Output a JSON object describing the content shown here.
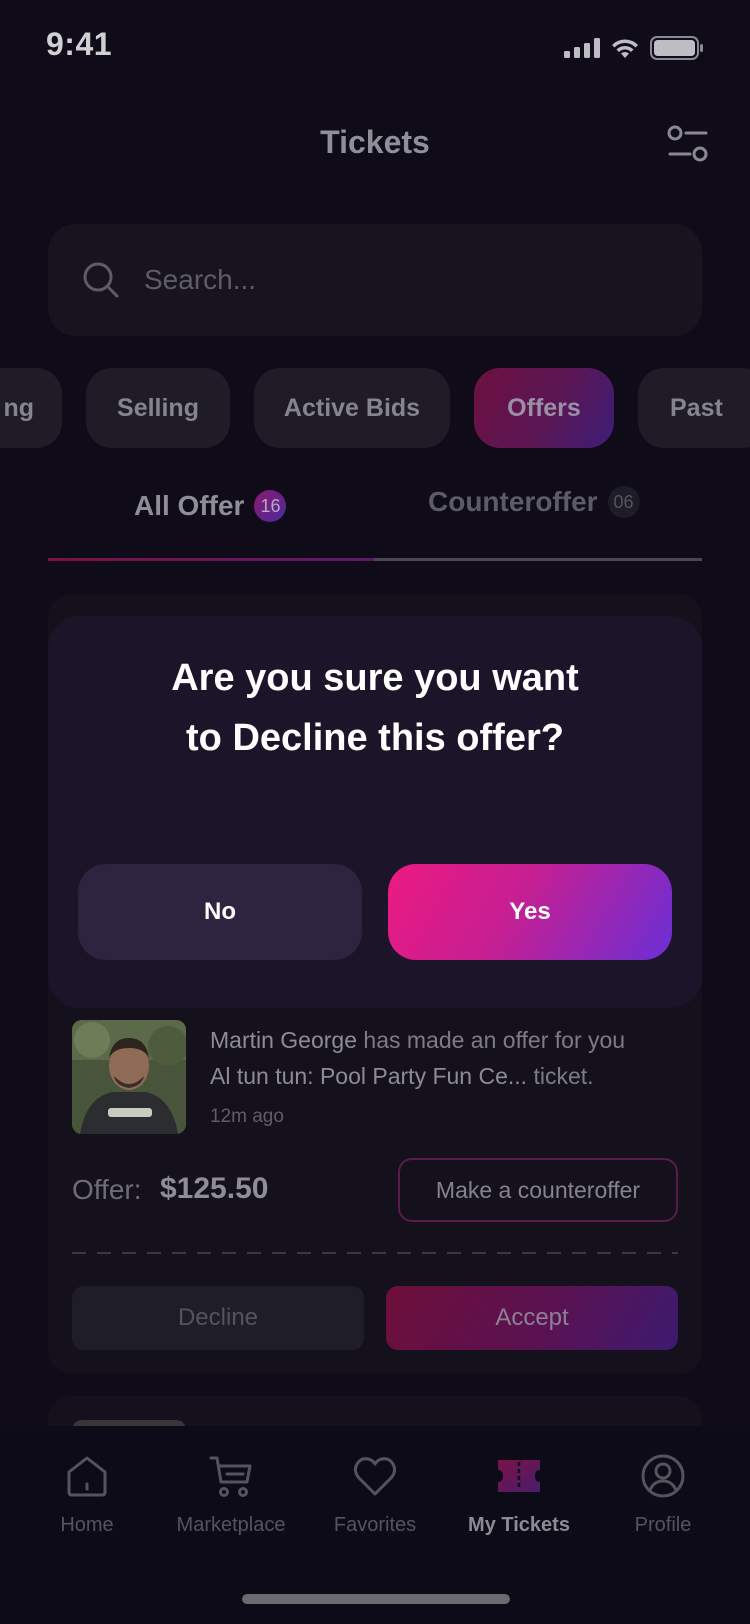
{
  "status_bar": {
    "time": "9:41"
  },
  "header": {
    "title": "Tickets"
  },
  "search": {
    "placeholder": "Search..."
  },
  "categories": [
    {
      "label": "ng"
    },
    {
      "label": "Selling"
    },
    {
      "label": "Active Bids"
    },
    {
      "label": "Offers",
      "active": true
    },
    {
      "label": "Past"
    }
  ],
  "offer_tabs": [
    {
      "label": "All Offer",
      "count": "16",
      "active": true
    },
    {
      "label": "Counteroffer",
      "count": "06"
    }
  ],
  "offer_card": {
    "user_name": "Martin George",
    "message_middle": "has made an offer for you",
    "event_name": "Al tun tun: Pool Party Fun Ce...",
    "message_end": "ticket.",
    "time": "12m ago",
    "offer_label": "Offer:",
    "offer_amount": "$125.50",
    "counter_label": "Make a counteroffer",
    "decline_label": "Decline",
    "accept_label": "Accept",
    "avatar_shirt_text": "knowtify"
  },
  "modal": {
    "title_line1": "Are you sure you want",
    "title_line2": "to Decline this offer?",
    "no_label": "No",
    "yes_label": "Yes"
  },
  "bottom_nav": [
    {
      "label": "Home",
      "icon": "home-icon"
    },
    {
      "label": "Marketplace",
      "icon": "cart-icon"
    },
    {
      "label": "Favorites",
      "icon": "heart-icon"
    },
    {
      "label": "My Tickets",
      "icon": "ticket-icon",
      "active": true
    },
    {
      "label": "Profile",
      "icon": "profile-icon"
    }
  ],
  "colors": {
    "background": "#0f0b19",
    "accent_pink": "#ec1a82",
    "accent_purple": "#6a2fd6",
    "modal_bg": "#1c1428"
  }
}
